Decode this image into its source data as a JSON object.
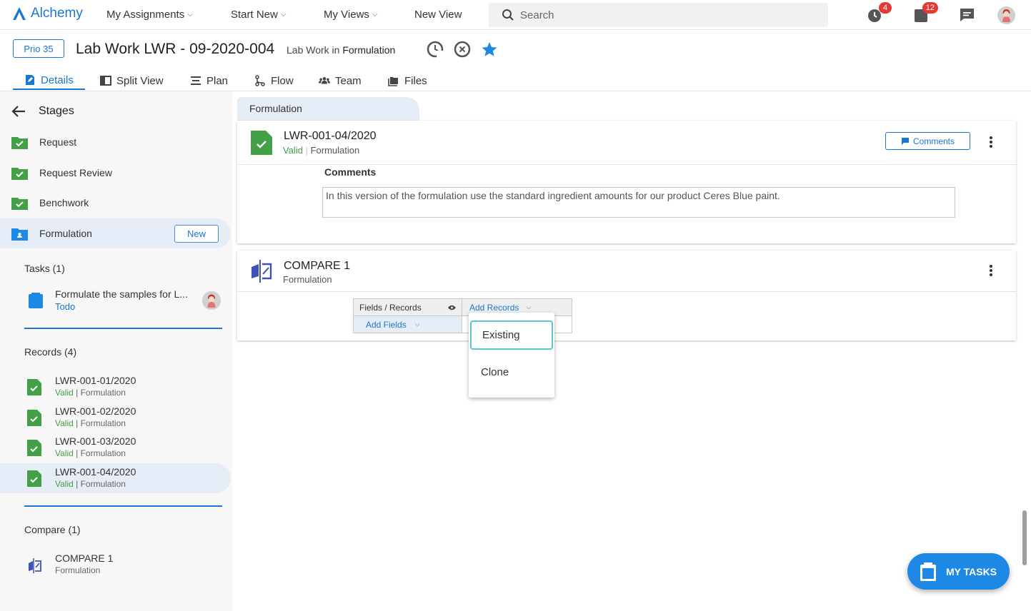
{
  "app": {
    "name": "Alchemy",
    "brand_color": "#1976d2"
  },
  "nav": {
    "items": [
      {
        "label": "My Assignments",
        "dropdown": true
      },
      {
        "label": "Start New",
        "dropdown": true
      },
      {
        "label": "My Views",
        "dropdown": true
      },
      {
        "label": "New View",
        "dropdown": false
      }
    ],
    "search_placeholder": "Search",
    "notifications_badge": "4",
    "tasks_badge": "12"
  },
  "header": {
    "priority": "Prio 35",
    "title": "Lab Work LWR - 09-2020-004",
    "subtitle_prefix": "Lab Work in",
    "subtitle_stage": "Formulation"
  },
  "tabs": [
    {
      "label": "Details",
      "icon": "details-icon",
      "active": true
    },
    {
      "label": "Split View",
      "icon": "split-view-icon"
    },
    {
      "label": "Plan",
      "icon": "plan-icon"
    },
    {
      "label": "Flow",
      "icon": "flow-icon"
    },
    {
      "label": "Team",
      "icon": "team-icon"
    },
    {
      "label": "Files",
      "icon": "files-icon"
    }
  ],
  "sidebar": {
    "title": "Stages",
    "stages": [
      {
        "label": "Request",
        "status": "done"
      },
      {
        "label": "Request Review",
        "status": "done"
      },
      {
        "label": "Benchwork",
        "status": "done"
      },
      {
        "label": "Formulation",
        "status": "active",
        "button": "New"
      }
    ],
    "tasks_title": "Tasks (1)",
    "tasks": [
      {
        "label": "Formulate the samples for L...",
        "status": "Todo"
      }
    ],
    "records_title": "Records (4)",
    "records": [
      {
        "id": "LWR-001-01/2020",
        "status": "Valid",
        "stage": "| Formulation"
      },
      {
        "id": "LWR-001-02/2020",
        "status": "Valid",
        "stage": "| Formulation"
      },
      {
        "id": "LWR-001-03/2020",
        "status": "Valid",
        "stage": "| Formulation"
      },
      {
        "id": "LWR-001-04/2020",
        "status": "Valid",
        "stage": "| Formulation",
        "active": true
      }
    ],
    "compare_title": "Compare (1)",
    "compares": [
      {
        "label": "COMPARE 1",
        "stage": "Formulation"
      }
    ]
  },
  "main": {
    "stage_chip": "Formulation",
    "record_card": {
      "title": "LWR-001-04/2020",
      "status": "Valid",
      "stage": "Formulation",
      "comments_button": "Comments",
      "comments_label": "Comments",
      "comments_text": "In this version of the formulation use the standard ingredient amounts for our product Ceres Blue paint."
    },
    "compare_card": {
      "title": "COMPARE 1",
      "stage": "Formulation",
      "grid": {
        "header": "Fields / Records",
        "add_records": "Add Records",
        "add_fields": "Add Fields"
      },
      "dropdown": [
        "Existing",
        "Clone"
      ]
    }
  },
  "fab": {
    "label": "MY TASKS"
  },
  "colors": {
    "valid": "#43a047",
    "accent": "#1976d2",
    "badge": "#e53935",
    "highlight": "#e6edf6"
  }
}
